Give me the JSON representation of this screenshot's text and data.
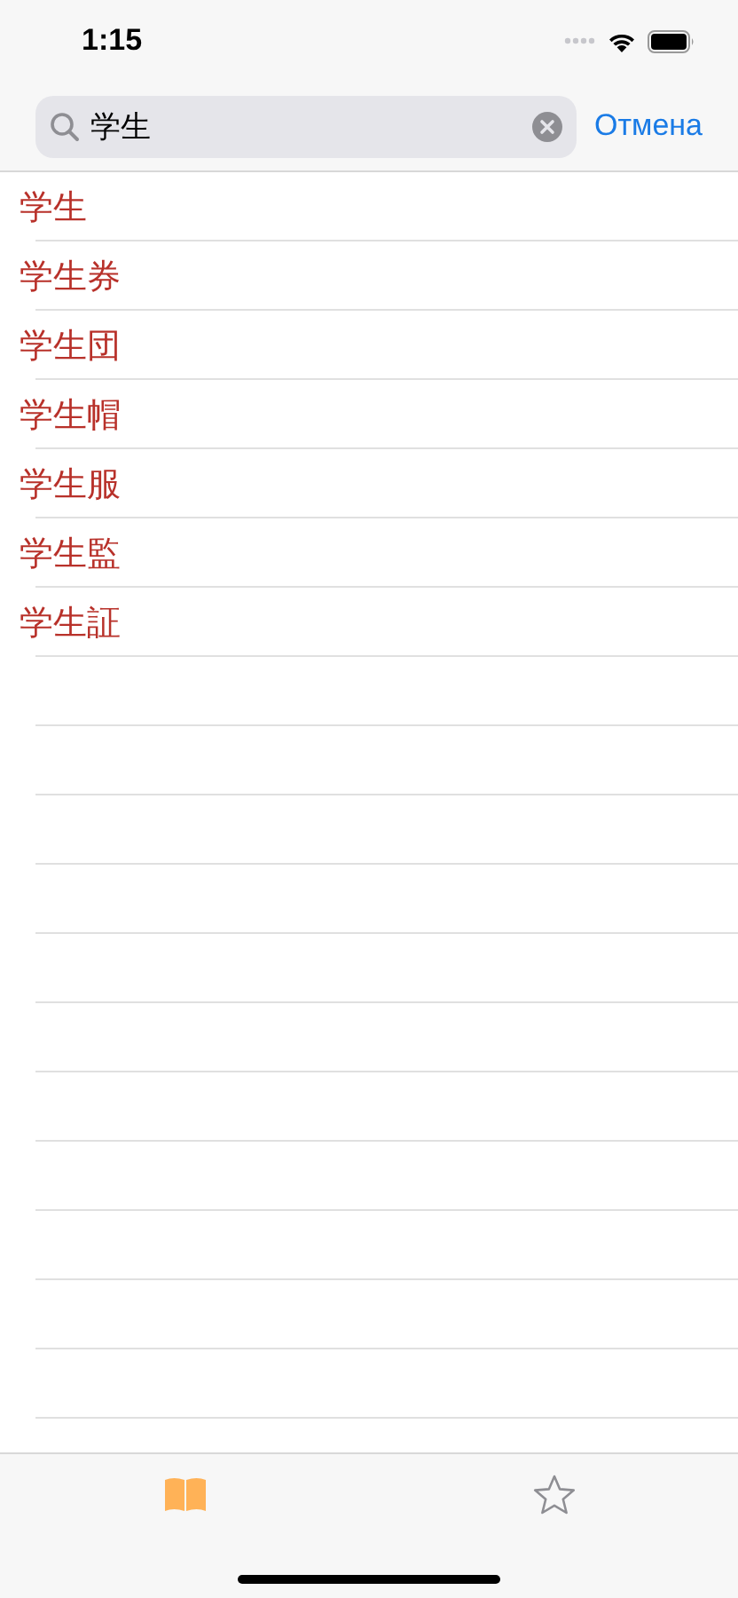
{
  "status_bar": {
    "time": "1:15"
  },
  "search": {
    "value": "学生",
    "cancel": "Отмена"
  },
  "results": [
    {
      "text": "学生"
    },
    {
      "text": "学生券"
    },
    {
      "text": "学生団"
    },
    {
      "text": "学生帽"
    },
    {
      "text": "学生服"
    },
    {
      "text": "学生監"
    },
    {
      "text": "学生証"
    }
  ],
  "tabs": [
    {
      "kind": "book",
      "selected": true
    },
    {
      "kind": "star",
      "selected": false
    }
  ]
}
